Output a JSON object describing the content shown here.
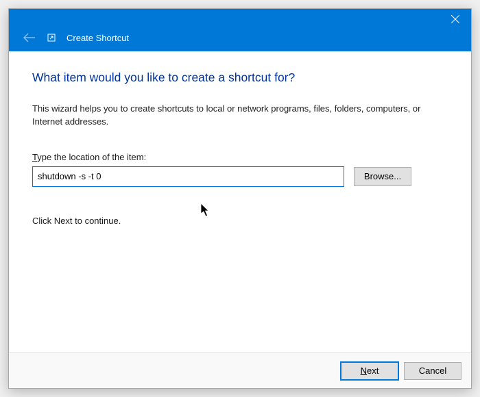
{
  "titlebar": {
    "title": "Create Shortcut"
  },
  "content": {
    "heading": "What item would you like to create a shortcut for?",
    "intro": "This wizard helps you to create shortcuts to local or network programs, files, folders, computers, or Internet addresses.",
    "field_label_prefix": "T",
    "field_label_rest": "ype the location of the item:",
    "location_value": "shutdown -s -t 0",
    "browse_label": "Browse...",
    "continue_text": "Click Next to continue."
  },
  "footer": {
    "next_prefix": "N",
    "next_rest": "ext",
    "cancel_label": "Cancel"
  },
  "colors": {
    "accent": "#0078d7",
    "heading": "#003399"
  }
}
